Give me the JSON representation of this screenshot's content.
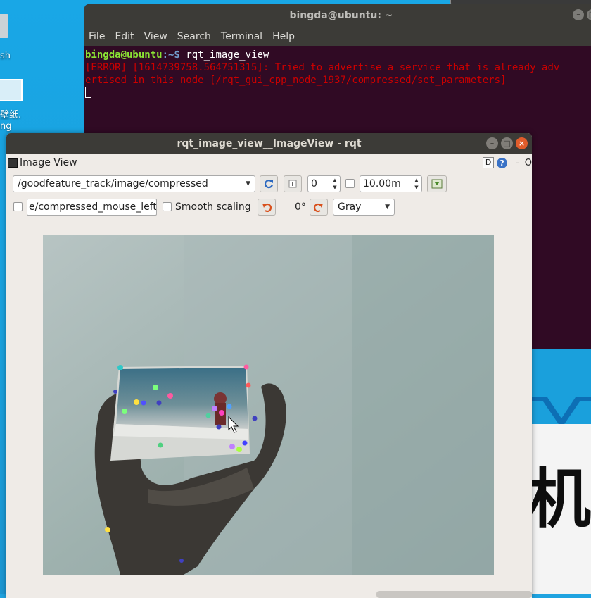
{
  "desktop": {
    "trash_label": "sh",
    "wallpaper_label_1": "壁纸.",
    "wallpaper_label_2": "ng",
    "wallpaper_glyph": "机"
  },
  "terminal": {
    "title": "bingda@ubuntu: ~",
    "menu": [
      "File",
      "Edit",
      "View",
      "Search",
      "Terminal",
      "Help"
    ],
    "prompt_user": "bingda@ubuntu",
    "prompt_path": ":~$ ",
    "command": "rqt_image_view",
    "error_line_1": "[ERROR] [1614739758.564751315]: Tried to advertise a service that is already adv",
    "error_line_2": "ertised in this node [/rqt_gui_cpp_node_1937/compressed/set_parameters]"
  },
  "rqt": {
    "title": "rqt_image_view__ImageView - rqt",
    "dock_title": "Image View",
    "dock_d": "D",
    "dock_help": "?",
    "dock_dash": "-",
    "dock_o": "O",
    "topic": "/goodfeature_track/image/compressed",
    "spin_value": "0",
    "timeout_value": "10.00m",
    "mouse_topic": "e/compressed_mouse_left",
    "smooth_scaling_label": "Smooth scaling",
    "rotation_label": "0°",
    "color_scheme": "Gray"
  },
  "colors": {
    "terminal_bg": "#300a24",
    "titlebar": "#3c3b37",
    "error": "#cc0000",
    "prompt_user": "#8ae234",
    "prompt_path": "#729fcf",
    "window_bg": "#efebe7",
    "close_button": "#e05c2b"
  }
}
